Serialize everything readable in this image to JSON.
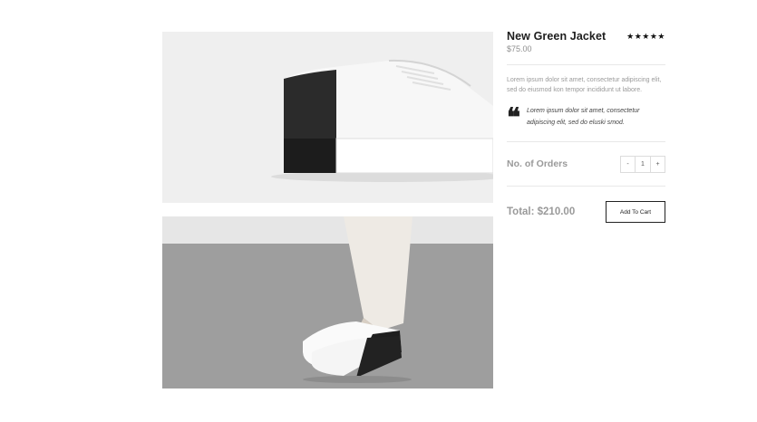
{
  "product": {
    "title": "New Green Jacket",
    "rating": 5,
    "rating_display": "★★★★★",
    "price": "$75.00",
    "description": "Lorem ipsum dolor sit amet, consectetur adipiscing elit, sed do eiusmod kon tempor incididunt ut labore.",
    "quote_mark": "❝",
    "quote": "Lorem ipsum dolor sit amet, consectetur adipiscing elit, sed do eluski smod."
  },
  "order": {
    "label": "No. of Orders",
    "decrement": "-",
    "quantity": "1",
    "increment": "+",
    "total": "Total: $210.00",
    "add_to_cart": "Add To Cart"
  },
  "images": {
    "main": "sneaker-side-view",
    "secondary": "sneaker-on-foot"
  },
  "colors": {
    "text_dark": "#1e1e1e",
    "text_muted": "#9a9a9a",
    "border": "#222222"
  }
}
